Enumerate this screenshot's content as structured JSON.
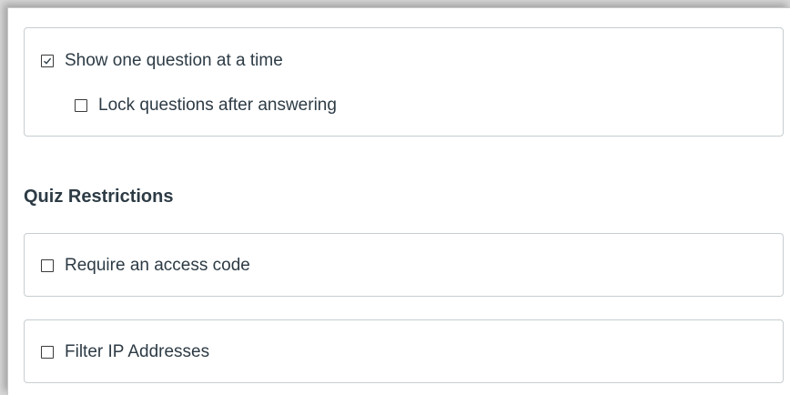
{
  "quiz_options": {
    "show_one_question": {
      "label": "Show one question at a time",
      "checked": true
    },
    "lock_questions": {
      "label": "Lock questions after answering",
      "checked": false
    }
  },
  "quiz_restrictions": {
    "heading": "Quiz Restrictions",
    "require_access_code": {
      "label": "Require an access code",
      "checked": false
    },
    "filter_ip": {
      "label": "Filter IP Addresses",
      "checked": false
    }
  },
  "colors": {
    "text": "#2d3b45",
    "border": "#c7cdd1",
    "checkbox_border": "#3a3a3a"
  }
}
